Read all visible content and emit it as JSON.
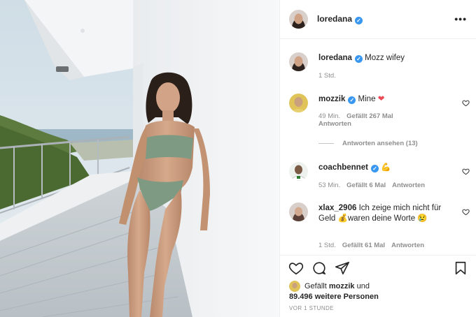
{
  "post": {
    "author": "loredana",
    "caption": "Mozz wifey",
    "caption_time": "1 Std."
  },
  "comments": [
    {
      "user": "mozzik",
      "verified": true,
      "text": "Mine",
      "emoji": "❤",
      "time": "49 Min.",
      "likes": "Gefällt 267 Mal",
      "reply_label": "Antworten",
      "view_replies": "Antworten ansehen (13)"
    },
    {
      "user": "coachbennet",
      "verified": true,
      "text": "",
      "emoji": "💪",
      "time": "53 Min.",
      "likes": "Gefällt 6 Mal",
      "reply_label": "Antworten"
    },
    {
      "user": "xlax_2906",
      "verified": false,
      "text_part1": "Ich zeige mich nicht für Geld",
      "emoji1": "💰",
      "text_part2": "waren deine Worte",
      "emoji2": "😢",
      "time": "1 Std.",
      "likes": "Gefällt 61 Mal",
      "reply_label": "Antworten"
    }
  ],
  "likes_summary": {
    "prefix": "Gefällt",
    "user": "mozzik",
    "connector": "und",
    "others": "89.496 weitere Personen"
  },
  "post_time": "VOR 1 STUNDE",
  "icons": {
    "more": "more-horizontal-icon",
    "like": "heart-icon",
    "comment": "comment-icon",
    "share": "share-icon",
    "save": "bookmark-icon"
  },
  "colors": {
    "verified": "#3897f0",
    "text": "#262626",
    "muted": "#8e8e8e",
    "heart": "#ed4956"
  }
}
